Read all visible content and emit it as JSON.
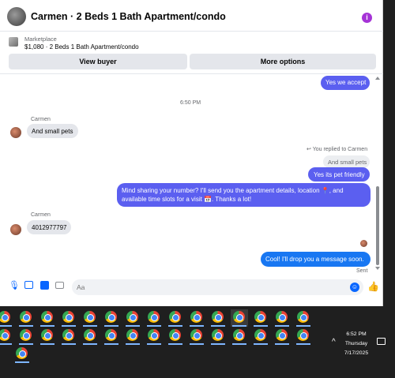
{
  "header": {
    "title": "Carmen · 2 Beds 1 Bath Apartment/condo",
    "info_icon": "info-icon",
    "accent": "#a533d6"
  },
  "marketplace": {
    "label": "Marketplace",
    "item": "$1,080 · 2 Beds 1 Bath Apartment/condo"
  },
  "actions": {
    "view_buyer": "View buyer",
    "more_options": "More options"
  },
  "messages": {
    "m1": "Yes we accept",
    "time": "6:50 PM",
    "sender1": "Carmen",
    "m2": "And small pets",
    "replied_label": "You replied to Carmen",
    "quoted": "And small pets",
    "m3": "Yes its pet friendly",
    "m4_line1": "Mind sharing your number? I'll send you the apartment details, location 📍, and",
    "m4_line2": "available time slots for a visit 📅. Thanks a lot!",
    "sender2": "Carmen",
    "m5": "4012977797",
    "m6": "Cool! I'll drop you a message soon.",
    "status": "Sent"
  },
  "composer": {
    "placeholder": "Aa"
  },
  "taskbar": {
    "time": "6:52 PM",
    "day": "Thursday",
    "date": "7/17/2025"
  },
  "colors": {
    "outgoing": "#5b5ff0",
    "incoming": "#e4e6eb",
    "messenger_blue": "#0866ff"
  }
}
